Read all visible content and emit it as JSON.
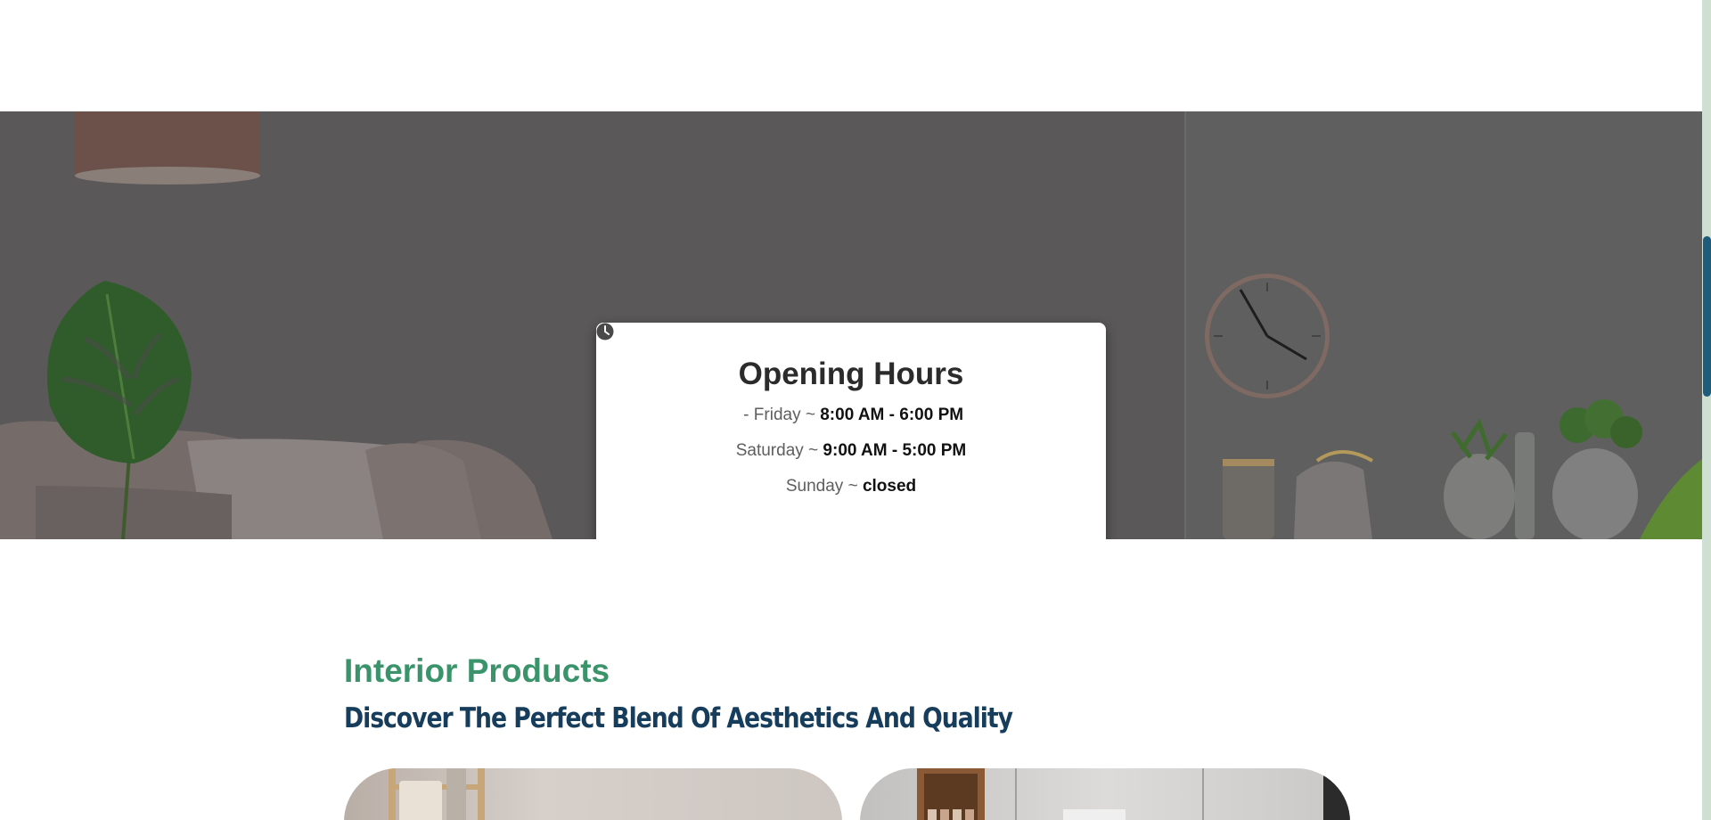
{
  "opening_hours": {
    "title": "Opening Hours",
    "icon": "clock-icon",
    "rows": [
      {
        "day": " - Friday ~ ",
        "time": "8:00 AM - 6:00 PM"
      },
      {
        "day": "Saturday ~ ",
        "time": "9:00 AM - 5:00 PM"
      },
      {
        "day": "Sunday ~ ",
        "time": "closed"
      }
    ]
  },
  "products": {
    "eyebrow": "Interior Products",
    "heading": "Discover The Perfect Blend Of Aesthetics And Quality"
  },
  "colors": {
    "accent_green": "#3a936a",
    "heading_navy": "#173d5c",
    "scrollbar_thumb": "#1f5b7a",
    "scrollbar_track": "#cfe0d3"
  }
}
